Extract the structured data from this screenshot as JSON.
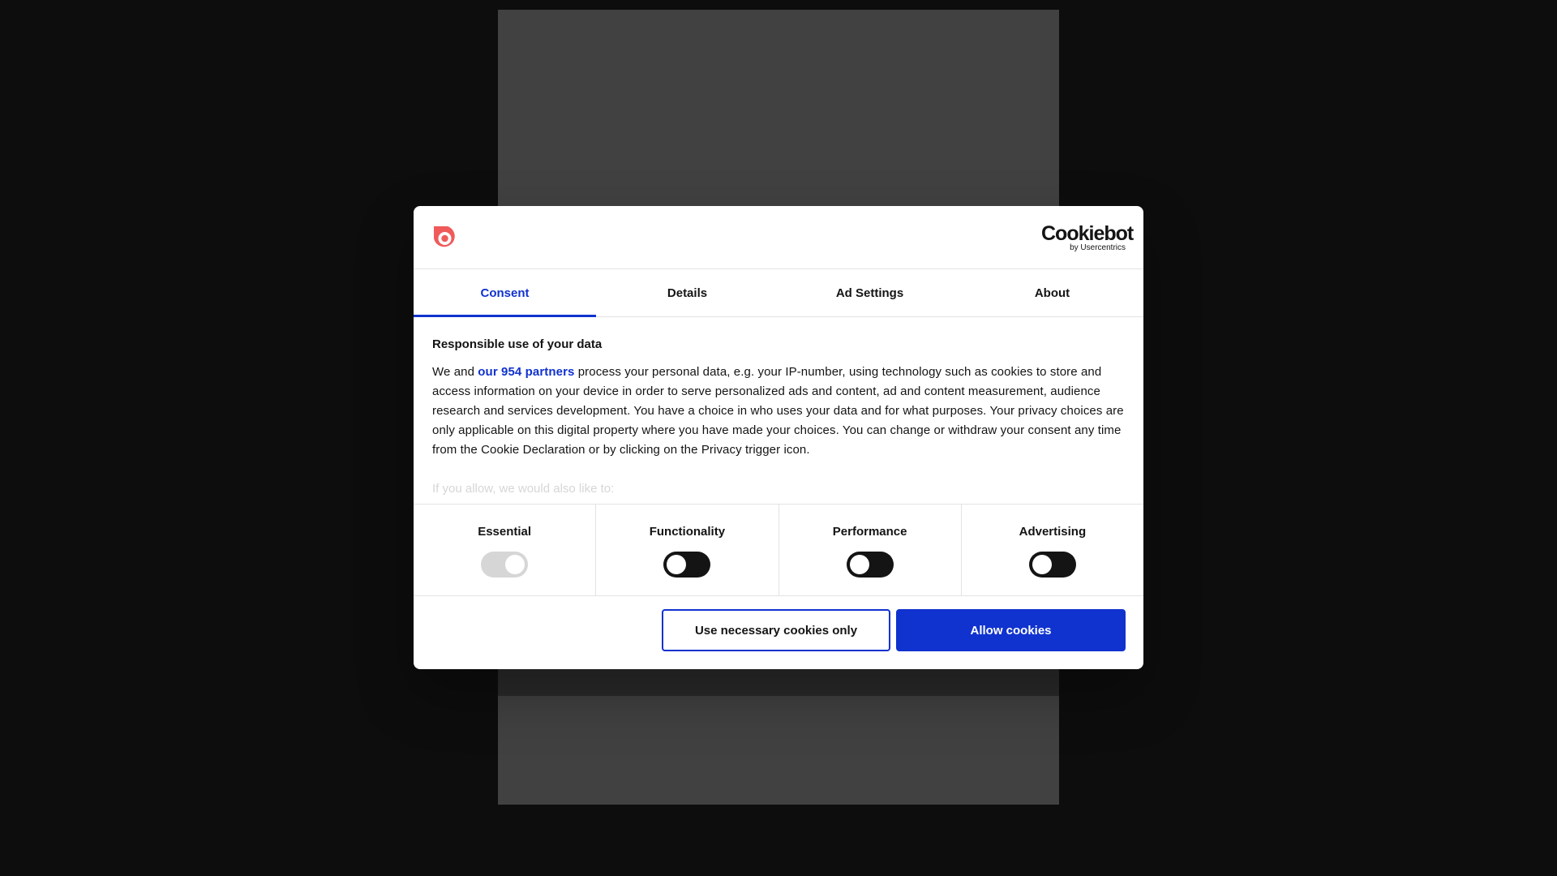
{
  "colors": {
    "accent": "#1032cf",
    "brand_logo": "#f05a5a",
    "text": "#141414",
    "overlay": "#0d0d0d"
  },
  "header": {
    "brand_logo_icon": "target-icon",
    "cookiebot_logo": {
      "word": "Cookiebot",
      "sub": "by Usercentrics"
    }
  },
  "tabs": [
    {
      "label": "Consent",
      "active": true
    },
    {
      "label": "Details",
      "active": false
    },
    {
      "label": "Ad Settings",
      "active": false
    },
    {
      "label": "About",
      "active": false
    }
  ],
  "body": {
    "title": "Responsible use of your data",
    "text_before_link": "We and ",
    "partners_link": "our 954 partners",
    "text_after_link": " process your personal data, e.g. your IP-number, using technology such as cookies to store and access information on your device in order to serve personalized ads and content, ad and content measurement, audience research and services development. You have a choice in who uses your data and for what purposes. Your privacy choices are only applicable on this digital property where you have made your choices. You can change or withdraw your consent any time from the Cookie Declaration or by clicking on the Privacy trigger icon.",
    "faded_text": "If you allow, we would also like to:"
  },
  "toggles": [
    {
      "label": "Essential",
      "on": true,
      "disabled": true
    },
    {
      "label": "Functionality",
      "on": false,
      "disabled": false
    },
    {
      "label": "Performance",
      "on": false,
      "disabled": false
    },
    {
      "label": "Advertising",
      "on": false,
      "disabled": false
    }
  ],
  "footer": {
    "necessary_button": "Use necessary cookies only",
    "allow_button": "Allow cookies"
  }
}
